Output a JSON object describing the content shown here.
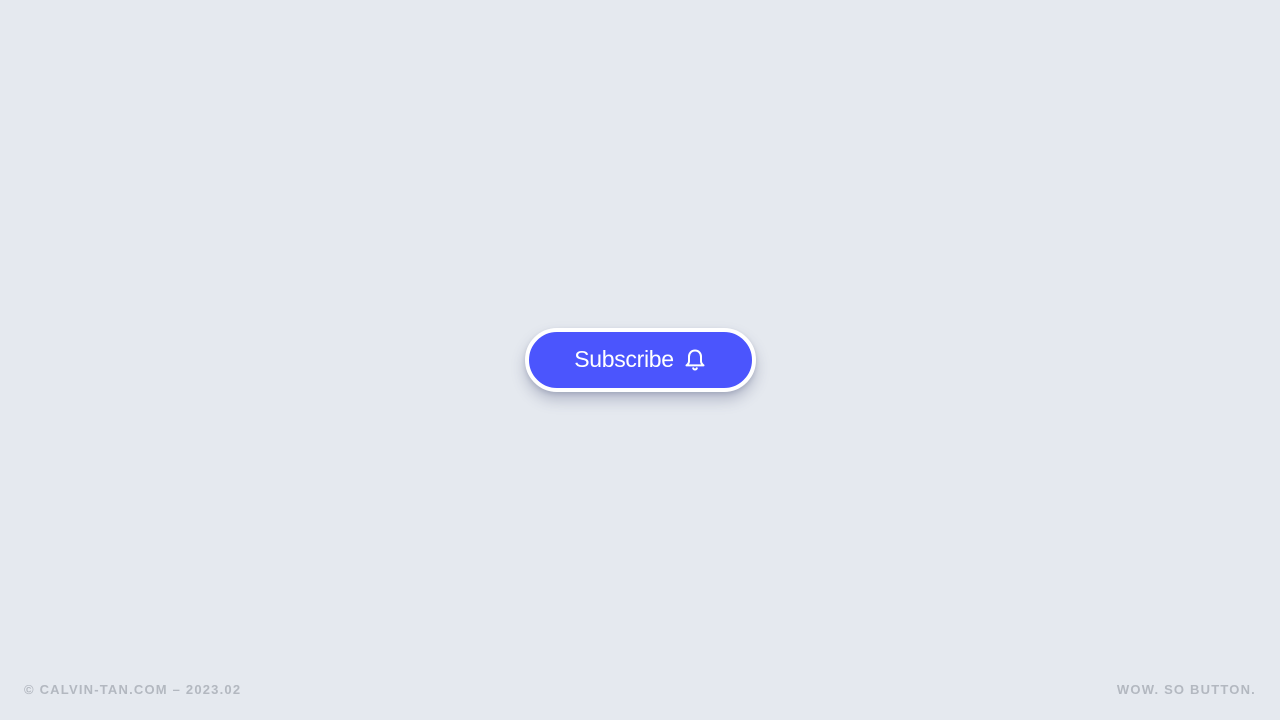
{
  "button": {
    "label": "Subscribe",
    "icon": "bell-icon",
    "color": "#4b55fd",
    "border_color": "#ffffff"
  },
  "page": {
    "background": "#e5e9ef"
  },
  "footer": {
    "credit": "© CALVIN-TAN.COM – 2023.02",
    "tagline": "WOW. SO BUTTON."
  }
}
